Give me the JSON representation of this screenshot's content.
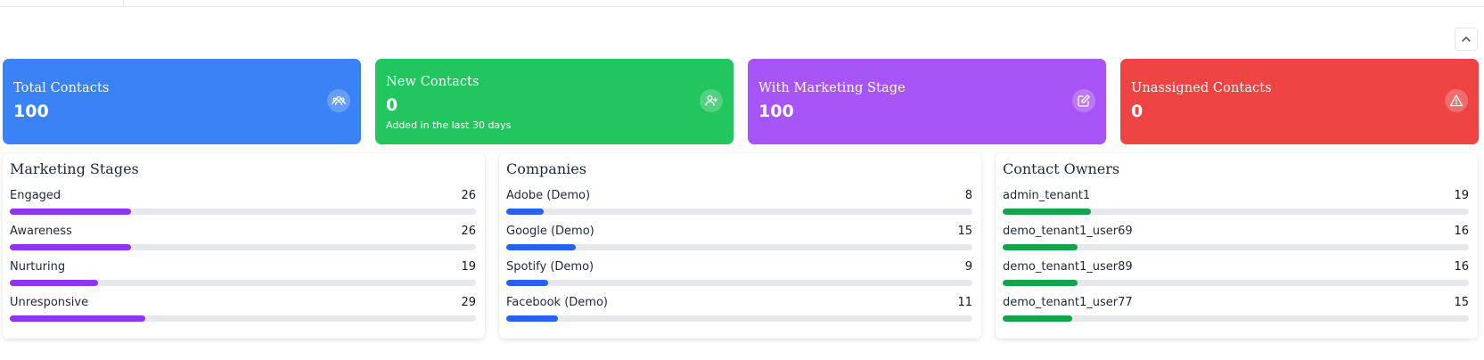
{
  "stat_cards": [
    {
      "title": "Total Contacts",
      "value": "100",
      "subtitle": "",
      "color": "#3b82f6",
      "icon": "users-group-icon"
    },
    {
      "title": "New Contacts",
      "value": "0",
      "subtitle": "Added in the last 30 days",
      "color": "#22c55e",
      "icon": "user-plus-icon"
    },
    {
      "title": "With Marketing Stage",
      "value": "100",
      "subtitle": "",
      "color": "#a855f7",
      "icon": "edit-icon"
    },
    {
      "title": "Unassigned Contacts",
      "value": "0",
      "subtitle": "",
      "color": "#ef4444",
      "icon": "warning-icon"
    }
  ],
  "panels": [
    {
      "title": "Marketing Stages",
      "bar_color": "#9333ea",
      "items": [
        {
          "label": "Engaged",
          "value": "26",
          "fraction": 0.26
        },
        {
          "label": "Awareness",
          "value": "26",
          "fraction": 0.26
        },
        {
          "label": "Nurturing",
          "value": "19",
          "fraction": 0.19
        },
        {
          "label": "Unresponsive",
          "value": "29",
          "fraction": 0.29
        }
      ]
    },
    {
      "title": "Companies",
      "bar_color": "#2563eb",
      "items": [
        {
          "label": "Adobe (Demo)",
          "value": "8",
          "fraction": 0.08
        },
        {
          "label": "Google (Demo)",
          "value": "15",
          "fraction": 0.15
        },
        {
          "label": "Spotify (Demo)",
          "value": "9",
          "fraction": 0.09
        },
        {
          "label": "Facebook (Demo)",
          "value": "11",
          "fraction": 0.11
        }
      ]
    },
    {
      "title": "Contact Owners",
      "bar_color": "#16a34a",
      "items": [
        {
          "label": "admin_tenant1",
          "value": "19",
          "fraction": 0.19
        },
        {
          "label": "demo_tenant1_user69",
          "value": "16",
          "fraction": 0.16
        },
        {
          "label": "demo_tenant1_user89",
          "value": "16",
          "fraction": 0.16
        },
        {
          "label": "demo_tenant1_user77",
          "value": "15",
          "fraction": 0.15
        }
      ]
    }
  ]
}
